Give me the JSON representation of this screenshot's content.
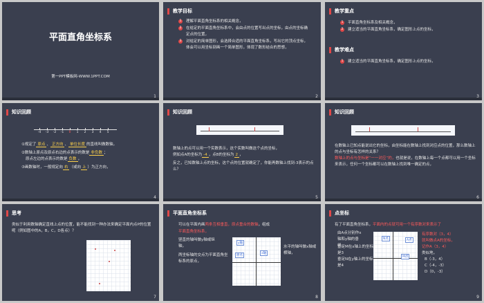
{
  "slides": {
    "s1": {
      "title": "平面直角坐标系",
      "site": "第一PPT模板网-WWW.1PPT.COM",
      "num": "1"
    },
    "s2": {
      "header": "教学目标",
      "items": [
        "理解平面直角坐标系的相关概念，",
        "在给定的平面直角坐标系中，会由点的位置写出点的坐标，由点的坐标确定点的位置，",
        "对给定的简单图形，会选择合适的平面直角坐标系，写出它的顶点坐标，体会可以用坐标刻画一个简单图形，体现了数形结合的思想，"
      ],
      "num": "2"
    },
    "s3": {
      "header1": "教学重点",
      "items1": [
        "平面直角坐标系及相关概念，",
        "建立适当的平面直角坐标系，确定图形上点的坐标，"
      ],
      "header2": "教学难点",
      "items2": [
        "建立适当的平面直角坐标系，确定图形上点的坐标，"
      ],
      "num": "3"
    },
    "s4": {
      "header": "知识回顾",
      "ticks": [
        "-4",
        "-3",
        "-2",
        "-1",
        "0",
        "1",
        "2",
        "3",
        "4",
        "5"
      ],
      "l1a": "①规定了",
      "l1b": "原点",
      "l1c": "正方向",
      "l1d": "单位长度",
      "l1e": "的直线叫做数轴，",
      "l2a": "②数轴上原点及原点右边的点表示的数是",
      "l2b": "非负数",
      "l2c": "；",
      "l3a": "原点左边的点表示的数是",
      "l3b": "负数",
      "l3c": "，",
      "l4a": "③画数轴时，一般规定向",
      "l4b": "右",
      "l4c": "（或向",
      "l4d": "上",
      "l4e": "）为正方向，",
      "num": "4"
    },
    "s5": {
      "header": "知识回顾",
      "p1a": "数轴上的点可以用一个实数表示，这个实数叫做这个点的坐标，",
      "p1b": "例如点A的坐标为",
      "p1c": "-4",
      "p1d": "，点B的坐标为",
      "p1e": "2",
      "p1f": "，",
      "p2": "反之，已知数轴上点的坐标，这个点的位置就确定了，你能再数轴上找到-3表示的点么？",
      "num": "5"
    },
    "s6": {
      "header": "知识回顾",
      "p1": "在数轴上已知点能说出它的坐标，由坐标能在数轴上找到对应点的位置，那么数轴上的点与坐标有怎样的关系？",
      "p2a": "数轴上的点与坐标是“一一对应”的，",
      "p2b": "也就是说，在数轴上每一个点都可以用一个坐标来表示，任何一个坐标都可以在数轴上找到唯一确定的点，",
      "num": "6"
    },
    "s7": {
      "header": "思考",
      "p1": "类似于利用数轴确定直线上点的位置，能不能找到一种办法来确定平面内点P的位置呢（例如图中的A，B，C，D各点）？",
      "num": "7"
    },
    "s8": {
      "header": "平面直角坐标系",
      "p1a": "可以在平面内画",
      "p1b": "两条互相垂直，原点重合的数轴",
      "p1c": "，组成",
      "p1d": "平面直角坐标系，",
      "p2": "竖直的轴叫做y轴或纵轴，",
      "p3": "两坐标轴的交点为平面直角坐标系的原点，",
      "p4": "水平的轴叫做x轴或横轴，",
      "tag_y": "y轴",
      "tag_x": "x轴",
      "tag_o": "原点",
      "num": "8"
    },
    "s9": {
      "header": "点坐标",
      "p1a": "有了平面直角坐标系，",
      "p1b": "平面内的点就可用一个有序数对来表示了",
      "p2": "由A点分别作x轴和y轴的垂线，",
      "p3": "垂足M在x轴上的坐标是3",
      "p4": "垂足N在y轴上的坐标是4",
      "r1": "有序数对（3，4）",
      "r2": "就叫做点A的坐标，",
      "r3": "记作A（3，4）",
      "r4": "类似地，",
      "pts": [
        "B（-3，4）",
        "C（-4，-3）",
        "D（0，-3）"
      ],
      "tag_a": "A点",
      "tag_n": "N点",
      "tag_m": "M点",
      "num": "9"
    }
  }
}
